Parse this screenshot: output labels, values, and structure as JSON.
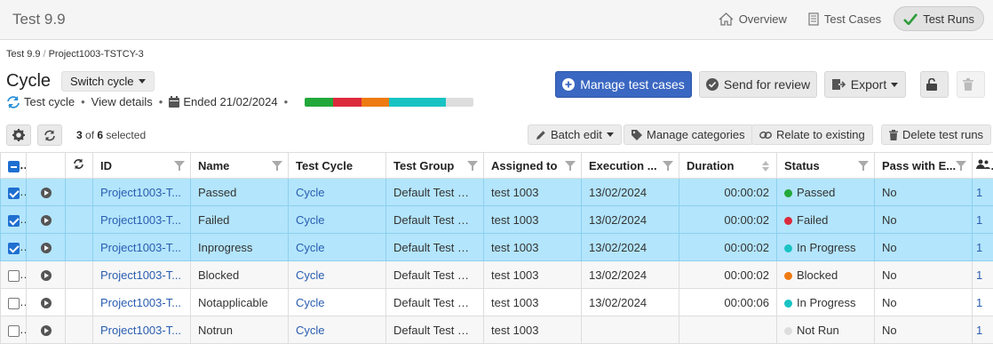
{
  "app": {
    "title": "Test 9.9"
  },
  "topnav": {
    "overview": "Overview",
    "test_cases": "Test Cases",
    "test_runs": "Test Runs"
  },
  "breadcrumb": {
    "root": "Test 9.9",
    "sep": "/",
    "current": "Project1003-TSTCY-3"
  },
  "cycle": {
    "title": "Cycle",
    "switch_label": "Switch cycle",
    "name": "Test cycle",
    "view_details": "View details",
    "ended": "Ended 21/02/2024",
    "progress": [
      {
        "status": "Passed",
        "fraction": 0.1667,
        "color": "#22a83a"
      },
      {
        "status": "Failed",
        "fraction": 0.1667,
        "color": "#dc2a3c"
      },
      {
        "status": "Blocked",
        "fraction": 0.1667,
        "color": "#ee7a12"
      },
      {
        "status": "In Progress",
        "fraction": 0.3333,
        "color": "#19c3c3"
      },
      {
        "status": "Not Run",
        "fraction": 0.1667,
        "color": "#dddddd"
      }
    ]
  },
  "actions": {
    "manage_test_cases": "Manage test cases",
    "send_for_review": "Send for review",
    "export": "Export"
  },
  "toolbar": {
    "selected_count": "3",
    "selected_of": "of",
    "selected_total": "6",
    "selected_suffix": "selected",
    "batch_edit": "Batch edit",
    "manage_categories": "Manage categories",
    "relate_to_existing": "Relate to existing",
    "delete_test_runs": "Delete test runs"
  },
  "table": {
    "headers": {
      "id": "ID",
      "name": "Name",
      "test_cycle": "Test Cycle",
      "test_group": "Test Group",
      "assigned_to": "Assigned to",
      "execution": "Execution ...",
      "duration": "Duration",
      "status": "Status",
      "pass_with": "Pass with E..."
    },
    "rows": [
      {
        "selected": true,
        "id": "Project1003-T...",
        "name": "Passed",
        "cycle": "Cycle",
        "group": "Default Test Gr...",
        "assigned": "test 1003",
        "execution": "13/02/2024",
        "duration": "00:00:02",
        "status": "Passed",
        "status_color": "#22a83a",
        "pass_with": "No",
        "extra": "1"
      },
      {
        "selected": true,
        "id": "Project1003-T...",
        "name": "Failed",
        "cycle": "Cycle",
        "group": "Default Test Gr...",
        "assigned": "test 1003",
        "execution": "13/02/2024",
        "duration": "00:00:02",
        "status": "Failed",
        "status_color": "#dc2a3c",
        "pass_with": "No",
        "extra": "1"
      },
      {
        "selected": true,
        "id": "Project1003-T...",
        "name": "Inprogress",
        "cycle": "Cycle",
        "group": "Default Test Gr...",
        "assigned": "test 1003",
        "execution": "13/02/2024",
        "duration": "00:00:02",
        "status": "In Progress",
        "status_color": "#19c3c3",
        "pass_with": "No",
        "extra": "1"
      },
      {
        "selected": false,
        "id": "Project1003-T...",
        "name": "Blocked",
        "cycle": "Cycle",
        "group": "Default Test Gr...",
        "assigned": "test 1003",
        "execution": "13/02/2024",
        "duration": "00:00:02",
        "status": "Blocked",
        "status_color": "#ee7a12",
        "pass_with": "No",
        "extra": "1"
      },
      {
        "selected": false,
        "id": "Project1003-T...",
        "name": "Notapplicable",
        "cycle": "Cycle",
        "group": "Default Test Gr...",
        "assigned": "test 1003",
        "execution": "13/02/2024",
        "duration": "00:00:06",
        "status": "In Progress",
        "status_color": "#19c3c3",
        "pass_with": "No",
        "extra": "1"
      },
      {
        "selected": false,
        "id": "Project1003-T...",
        "name": "Notrun",
        "cycle": "Cycle",
        "group": "Default Test Gr...",
        "assigned": "test 1003",
        "execution": "",
        "duration": "",
        "status": "Not Run",
        "status_color": "#dddddd",
        "pass_with": "No",
        "extra": "1"
      }
    ]
  }
}
